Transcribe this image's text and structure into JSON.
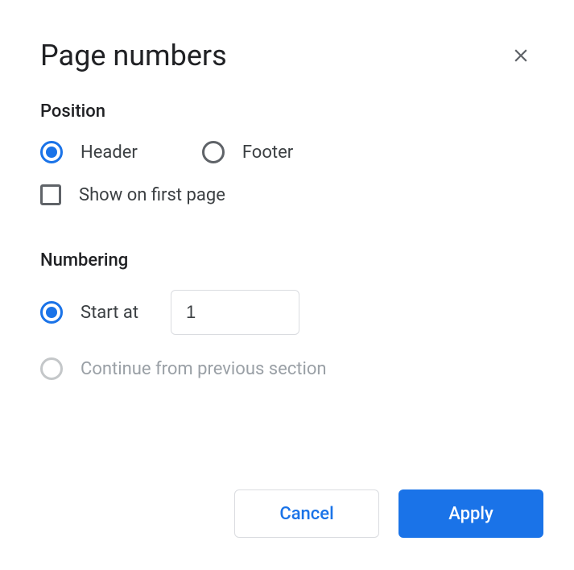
{
  "dialog": {
    "title": "Page numbers"
  },
  "position": {
    "section_title": "Position",
    "header_label": "Header",
    "footer_label": "Footer",
    "show_first_page_label": "Show on first page",
    "selected": "header",
    "show_on_first_page": false
  },
  "numbering": {
    "section_title": "Numbering",
    "start_at_label": "Start at",
    "start_at_value": "1",
    "continue_label": "Continue from previous section",
    "selected": "start_at",
    "continue_enabled": false
  },
  "actions": {
    "cancel_label": "Cancel",
    "apply_label": "Apply"
  }
}
